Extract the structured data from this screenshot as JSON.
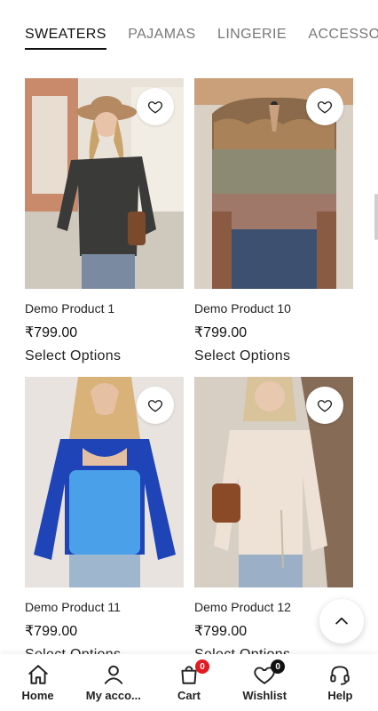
{
  "tabs": [
    {
      "label": "SWEATERS",
      "active": true
    },
    {
      "label": "PAJAMAS",
      "active": false
    },
    {
      "label": "LINGERIE",
      "active": false
    },
    {
      "label": "ACCESSO",
      "active": false
    }
  ],
  "products": [
    {
      "title": "Demo Product 1",
      "price": "₹799.00",
      "action": "Select Options",
      "wishlist_icon": "heart-icon"
    },
    {
      "title": "Demo Product 10",
      "price": "₹799.00",
      "action": "Select Options",
      "wishlist_icon": "heart-icon"
    },
    {
      "title": "Demo Product 11",
      "price": "₹799.00",
      "action": "Select Options",
      "wishlist_icon": "heart-icon"
    },
    {
      "title": "Demo Product 12",
      "price": "₹799.00",
      "action": "Select Options",
      "wishlist_icon": "heart-icon"
    }
  ],
  "bottom_nav": {
    "home": {
      "label": "Home",
      "icon": "home-icon"
    },
    "account": {
      "label": "My acco...",
      "icon": "user-icon"
    },
    "cart": {
      "label": "Cart",
      "icon": "bag-icon",
      "badge": "0"
    },
    "wishlist": {
      "label": "Wishlist",
      "icon": "heart-icon",
      "badge": "0"
    },
    "help": {
      "label": "Help",
      "icon": "headset-icon"
    }
  },
  "colors": {
    "badge_cart": "#e11b22",
    "badge_wishlist": "#111111",
    "text_primary": "#222222",
    "tab_inactive": "#777777"
  }
}
